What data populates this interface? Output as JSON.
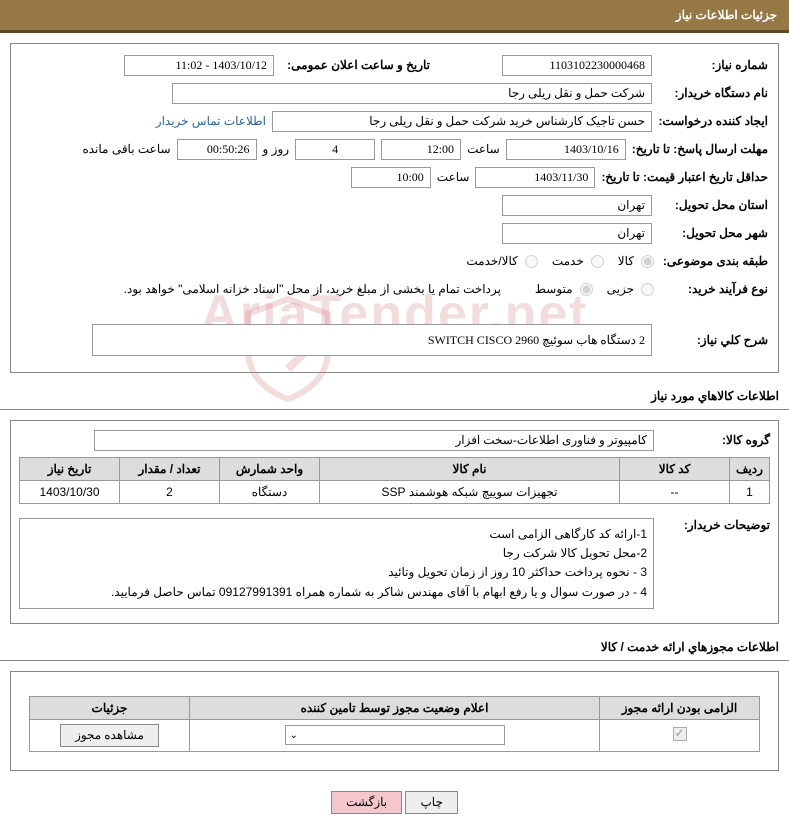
{
  "header": {
    "title": "جزئیات اطلاعات نیاز"
  },
  "watermark": "AriaTender.net",
  "need": {
    "label_number": "شماره نیاز:",
    "number": "1103102230000468",
    "label_announce": "تاریخ و ساعت اعلان عمومی:",
    "announce_datetime": "1403/10/12 - 11:02",
    "label_buyer_org": "نام دستگاه خریدار:",
    "buyer_org": "شرکت حمل و نقل ریلی رجا",
    "label_requester": "ایجاد کننده درخواست:",
    "requester": "حسن تاجیک کارشناس خرید شرکت حمل و نقل ریلی رجا",
    "contact_link": "اطلاعات تماس خریدار",
    "label_deadline": "مهلت ارسال پاسخ: تا تاریخ:",
    "deadline_date": "1403/10/16",
    "label_hour": "ساعت",
    "deadline_time": "12:00",
    "days_count": "4",
    "label_days_and": "روز و",
    "countdown": "00:50:26",
    "label_remaining": "ساعت باقی مانده",
    "label_validity": "حداقل تاریخ اعتبار قیمت: تا تاریخ:",
    "validity_date": "1403/11/30",
    "validity_time": "10:00",
    "label_province": "استان محل تحویل:",
    "province": "تهران",
    "label_city": "شهر محل تحویل:",
    "city": "تهران",
    "label_category": "طبقه بندی موضوعی:",
    "cat_goods": "کالا",
    "cat_service": "خدمت",
    "cat_goods_service": "کالا/خدمت",
    "label_process": "نوع فرآیند خرید:",
    "proc_partial": "جزیی",
    "proc_medium": "متوسط",
    "proc_note": "پرداخت تمام یا بخشی از مبلغ خرید، از محل \"اسناد خزانه اسلامی\" خواهد بود.",
    "label_desc": "شرح کلي نیاز:",
    "desc": "2 دستگاه هاب سوئیچ SWITCH CISCO 2960"
  },
  "goods_section": {
    "title": "اطلاعات کالاهاي مورد نیاز",
    "label_group": "گروه کالا:",
    "group": "کامپیوتر و فناوری اطلاعات-سخت افزار",
    "headers": {
      "row": "ردیف",
      "code": "کد کالا",
      "name": "نام کالا",
      "unit": "واحد شمارش",
      "qty": "تعداد / مقدار",
      "need_date": "تاریخ نیاز"
    },
    "rows": [
      {
        "n": "1",
        "code": "--",
        "name": "تجهیزات سوییچ شبکه هوشمند SSP",
        "unit": "دستگاه",
        "qty": "2",
        "need_date": "1403/10/30"
      }
    ],
    "label_buyer_notes": "توضیحات خریدار:",
    "notes_1": "1-ارائه کد کارگاهی الزامی است",
    "notes_2": "2-محل تحویل کالا  شرکت رجا",
    "notes_3": "3 - نحوه پرداخت حداکثر 10 روز از زمان تحویل وتائید",
    "notes_4": "4 - در صورت سوال و یا رفع ابهام با آقای مهندس شاکر به شماره همراه 09127991391 تماس حاصل فرمایید."
  },
  "license_section": {
    "title": "اطلاعات مجوزهاي ارائه خدمت / کالا",
    "headers": {
      "mandatory": "الزامی بودن ارائه مجوز",
      "status": "اعلام وضعیت مجوز توسط تامین کننده",
      "details": "جزئیات"
    },
    "view_btn": "مشاهده مجوز"
  },
  "buttons": {
    "print": "چاپ",
    "back": "بازگشت"
  }
}
